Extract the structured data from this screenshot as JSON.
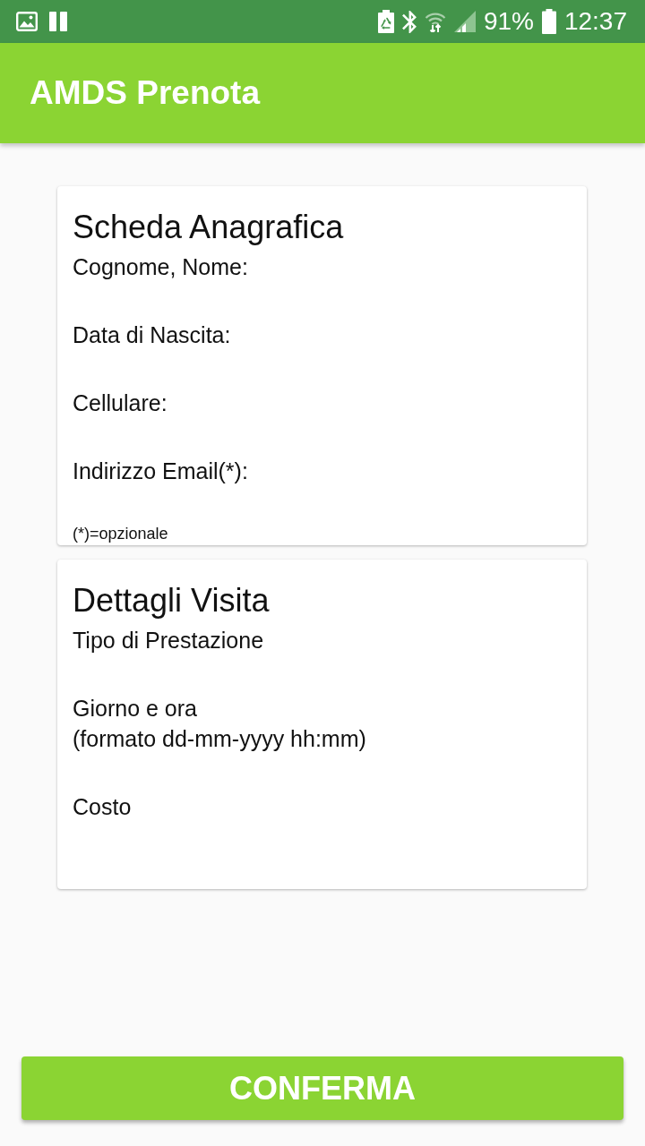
{
  "status_bar": {
    "battery": "91%",
    "time": "12:37"
  },
  "app_bar": {
    "title": "AMDS Prenota"
  },
  "cards": [
    {
      "title": "Scheda Anagrafica",
      "fields": [
        {
          "label": "Cognome, Nome:"
        },
        {
          "label": "Data di Nascita:"
        },
        {
          "label": "Cellulare:"
        },
        {
          "label": "Indirizzo Email(*):"
        }
      ],
      "note": "(*)=opzionale"
    },
    {
      "title": "Dettagli Visita",
      "fields": [
        {
          "label": "Tipo di Prestazione"
        },
        {
          "label": "Giorno e ora\n(formato dd-mm-yyyy hh:mm)"
        },
        {
          "label": "Costo"
        }
      ]
    }
  ],
  "confirm_button": {
    "label": "CONFERMA"
  }
}
